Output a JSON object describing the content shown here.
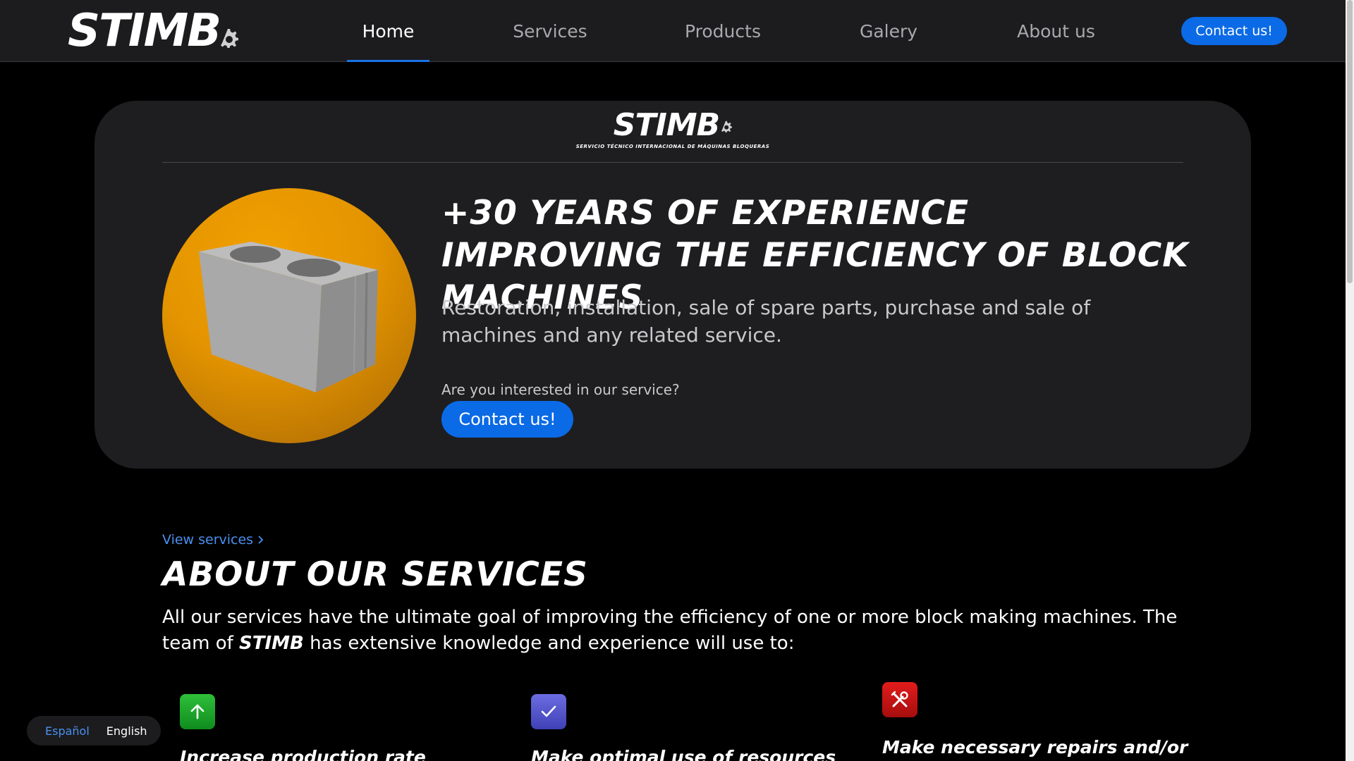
{
  "header": {
    "brand": "STIMB",
    "nav": [
      {
        "label": "Home",
        "active": true
      },
      {
        "label": "Services",
        "active": false
      },
      {
        "label": "Products",
        "active": false
      },
      {
        "label": "Galery",
        "active": false
      },
      {
        "label": "About us",
        "active": false
      }
    ],
    "contact_label": "Contact us!"
  },
  "hero": {
    "logo_text": "STIMB",
    "logo_subtitle": "SERVICIO TÉCNICO INTERNACIONAL DE MÁQUINAS BLOQUERAS",
    "title": "+30 YEARS OF EXPERIENCE IMPROVING THE EFFICIENCY OF BLOCK MACHINES",
    "description": "Restoration, installation, sale of spare parts, purchase and sale of machines and any related service.",
    "question": "Are you interested in our service?",
    "contact_label": "Contact us!"
  },
  "services": {
    "link_label": "View services",
    "title": "ABOUT OUR SERVICES",
    "text_before": "All our services have the ultimate goal of improving the efficiency of one or more block making machines. The team of ",
    "text_brand": "STIMB",
    "text_after": " has extensive knowledge and experience will use to:",
    "features": [
      {
        "title": "Increase production rate",
        "icon": "arrow-up-icon"
      },
      {
        "title": "Make optimal use of resources",
        "icon": "check-icon"
      },
      {
        "title": "Make necessary repairs and/or",
        "icon": "tools-icon"
      }
    ]
  },
  "language": {
    "spanish": "Español",
    "english": "English"
  },
  "colors": {
    "accent": "#0b6ae6",
    "link": "#4a90f0",
    "hero_circle": "#e49400"
  }
}
